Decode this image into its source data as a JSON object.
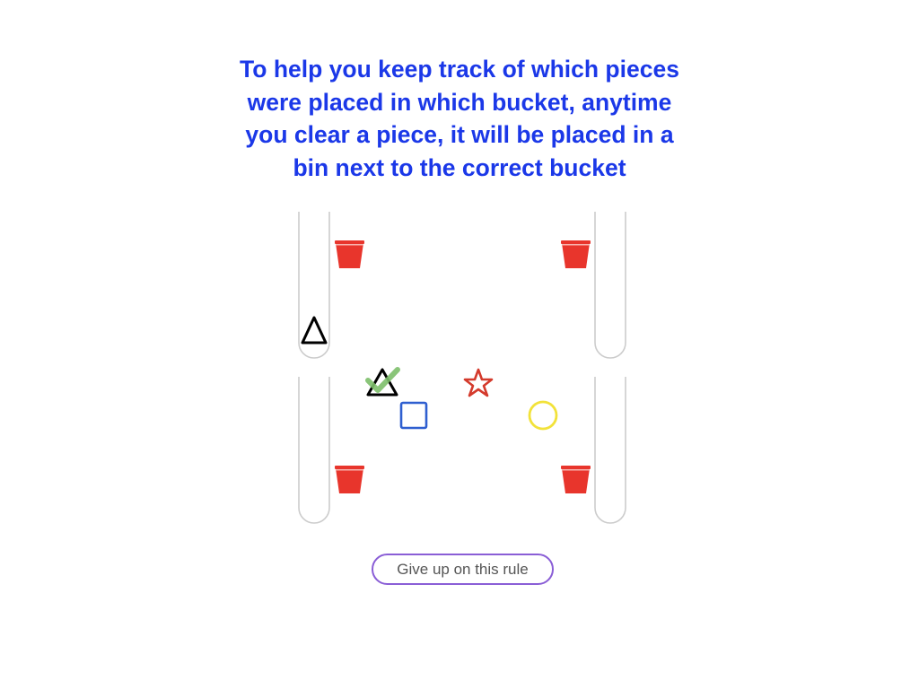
{
  "instruction": {
    "line1": "To help you keep track of which pieces",
    "line2": "were placed in which bucket, anytime",
    "line3": "you clear a piece, it will be placed in a",
    "line4": "bin next to the correct bucket"
  },
  "buttons": {
    "give_up_label": "Give up on this rule"
  },
  "colors": {
    "instruction_text": "#1b38e8",
    "bucket": "#e8352c",
    "bin_outline": "#cccccc",
    "triangle": "#000000",
    "star": "#d43a2c",
    "square": "#2f5fd0",
    "circle": "#f2e23a",
    "checkmark": "#7dbf6a",
    "button_border": "#8a5ed6"
  },
  "game": {
    "buckets": [
      "top-left",
      "top-right",
      "bottom-left",
      "bottom-right"
    ],
    "bins": [
      {
        "position": "top-left",
        "cleared_pieces": [
          "triangle"
        ]
      },
      {
        "position": "top-right",
        "cleared_pieces": []
      },
      {
        "position": "bottom-left",
        "cleared_pieces": []
      },
      {
        "position": "bottom-right",
        "cleared_pieces": []
      }
    ],
    "board_pieces": [
      {
        "shape": "triangle",
        "color": "black",
        "checked": true
      },
      {
        "shape": "star",
        "color": "red",
        "checked": false
      },
      {
        "shape": "square",
        "color": "blue",
        "checked": false
      },
      {
        "shape": "circle",
        "color": "yellow",
        "checked": false
      }
    ]
  }
}
